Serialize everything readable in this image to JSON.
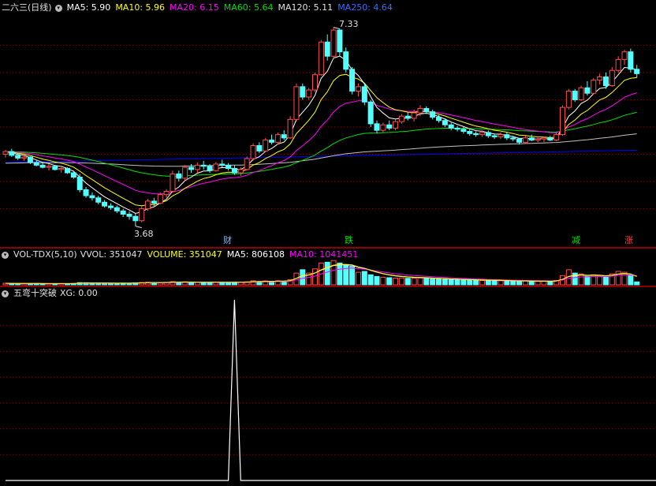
{
  "price_header": {
    "stock_name": "二六三(日线)",
    "ma5": "MA5: 5.90",
    "ma10": "MA10: 5.96",
    "ma20": "MA20: 6.15",
    "ma60": "MA60: 5.64",
    "ma120": "MA120: 5.11",
    "ma250": "MA250: 4.64"
  },
  "price_annotations": {
    "high": "7.33",
    "low": "3.68",
    "tags": [
      {
        "text": "财",
        "color": "#7fbfff"
      },
      {
        "text": "跌",
        "color": "#00e000"
      },
      {
        "text": "减",
        "color": "#00e000"
      },
      {
        "text": "涨",
        "color": "#ff4040"
      }
    ]
  },
  "vol_header": {
    "name": "VOL-TDX(5,10)",
    "vvol": "VVOL: 351047",
    "volume": "VOLUME: 351047",
    "ma5": "MA5: 806108",
    "ma10": "MA10: 1041451"
  },
  "ind_header": {
    "name": "五弯十突破",
    "xg": "XG: 0.00"
  },
  "colors": {
    "up": "#ff4c4c",
    "down": "#54ffff",
    "ma5": "#ffffff",
    "ma10": "#ffff00",
    "ma20": "#ff00ff",
    "ma60": "#00e000",
    "ma120": "#c0c0c0",
    "ma250": "#0000ff",
    "grid": "#8b0000"
  },
  "chart_data": [
    {
      "type": "candlestick",
      "title": "二六三(日线)",
      "ylim": [
        3.4,
        7.6
      ],
      "candles": [
        [
          5.0,
          5.08,
          4.94,
          5.05
        ],
        [
          5.05,
          5.1,
          4.95,
          4.98
        ],
        [
          4.98,
          5.02,
          4.9,
          4.93
        ],
        [
          4.93,
          4.98,
          4.88,
          4.95
        ],
        [
          4.95,
          4.96,
          4.82,
          4.85
        ],
        [
          4.85,
          4.9,
          4.78,
          4.8
        ],
        [
          4.8,
          4.86,
          4.74,
          4.76
        ],
        [
          4.76,
          4.82,
          4.7,
          4.78
        ],
        [
          4.78,
          4.8,
          4.7,
          4.72
        ],
        [
          4.72,
          4.76,
          4.66,
          4.74
        ],
        [
          4.74,
          4.76,
          4.64,
          4.66
        ],
        [
          4.66,
          4.7,
          4.55,
          4.58
        ],
        [
          4.58,
          4.64,
          4.3,
          4.35
        ],
        [
          4.35,
          4.4,
          4.2,
          4.24
        ],
        [
          4.24,
          4.3,
          4.15,
          4.2
        ],
        [
          4.2,
          4.24,
          4.08,
          4.12
        ],
        [
          4.12,
          4.16,
          4.02,
          4.05
        ],
        [
          4.05,
          4.1,
          3.98,
          4.02
        ],
        [
          4.02,
          4.06,
          3.92,
          3.96
        ],
        [
          3.96,
          4.0,
          3.85,
          3.9
        ],
        [
          3.9,
          3.95,
          3.8,
          3.86
        ],
        [
          3.86,
          3.92,
          3.68,
          3.78
        ],
        [
          3.78,
          4.05,
          3.75,
          4.0
        ],
        [
          4.0,
          4.18,
          3.96,
          4.14
        ],
        [
          4.14,
          4.2,
          4.05,
          4.1
        ],
        [
          4.1,
          4.3,
          4.08,
          4.26
        ],
        [
          4.26,
          4.36,
          4.2,
          4.32
        ],
        [
          4.32,
          4.7,
          4.3,
          4.64
        ],
        [
          4.64,
          4.7,
          4.5,
          4.56
        ],
        [
          4.56,
          4.8,
          4.52,
          4.76
        ],
        [
          4.76,
          4.82,
          4.66,
          4.72
        ],
        [
          4.72,
          4.85,
          4.66,
          4.8
        ],
        [
          4.8,
          4.88,
          4.72,
          4.78
        ],
        [
          4.78,
          4.82,
          4.66,
          4.7
        ],
        [
          4.7,
          4.86,
          4.68,
          4.82
        ],
        [
          4.82,
          4.9,
          4.76,
          4.8
        ],
        [
          4.8,
          4.84,
          4.7,
          4.74
        ],
        [
          4.74,
          4.8,
          4.62,
          4.66
        ],
        [
          4.66,
          4.76,
          4.6,
          4.72
        ],
        [
          4.72,
          4.96,
          4.7,
          4.92
        ],
        [
          4.92,
          5.2,
          4.88,
          5.16
        ],
        [
          5.16,
          5.22,
          5.02,
          5.06
        ],
        [
          5.06,
          5.3,
          5.04,
          5.26
        ],
        [
          5.26,
          5.36,
          5.18,
          5.22
        ],
        [
          5.22,
          5.4,
          5.18,
          5.36
        ],
        [
          5.36,
          5.44,
          5.26,
          5.3
        ],
        [
          5.3,
          5.7,
          5.28,
          5.64
        ],
        [
          5.64,
          6.3,
          5.6,
          6.24
        ],
        [
          6.24,
          6.3,
          6.0,
          6.05
        ],
        [
          6.05,
          6.22,
          6.0,
          6.18
        ],
        [
          6.18,
          6.5,
          6.14,
          6.46
        ],
        [
          6.46,
          7.1,
          6.44,
          7.06
        ],
        [
          7.06,
          7.2,
          6.72,
          6.8
        ],
        [
          6.8,
          7.33,
          6.76,
          7.28
        ],
        [
          7.28,
          7.3,
          6.8,
          6.88
        ],
        [
          6.88,
          6.96,
          6.5,
          6.56
        ],
        [
          6.56,
          6.6,
          6.1,
          6.16
        ],
        [
          6.16,
          6.3,
          6.06,
          6.24
        ],
        [
          6.24,
          6.3,
          5.9,
          5.96
        ],
        [
          5.96,
          6.0,
          5.5,
          5.56
        ],
        [
          5.56,
          5.62,
          5.38,
          5.44
        ],
        [
          5.44,
          5.58,
          5.4,
          5.54
        ],
        [
          5.54,
          5.62,
          5.44,
          5.48
        ],
        [
          5.48,
          5.64,
          5.44,
          5.6
        ],
        [
          5.6,
          5.74,
          5.56,
          5.7
        ],
        [
          5.7,
          5.76,
          5.62,
          5.66
        ],
        [
          5.66,
          5.82,
          5.6,
          5.76
        ],
        [
          5.76,
          5.9,
          5.7,
          5.84
        ],
        [
          5.84,
          5.88,
          5.74,
          5.78
        ],
        [
          5.78,
          5.82,
          5.64,
          5.68
        ],
        [
          5.68,
          5.72,
          5.58,
          5.62
        ],
        [
          5.62,
          5.66,
          5.5,
          5.54
        ],
        [
          5.54,
          5.58,
          5.44,
          5.48
        ],
        [
          5.48,
          5.52,
          5.42,
          5.46
        ],
        [
          5.46,
          5.5,
          5.38,
          5.42
        ],
        [
          5.42,
          5.46,
          5.34,
          5.38
        ],
        [
          5.38,
          5.42,
          5.32,
          5.36
        ],
        [
          5.36,
          5.44,
          5.32,
          5.4
        ],
        [
          5.4,
          5.44,
          5.3,
          5.34
        ],
        [
          5.34,
          5.38,
          5.28,
          5.32
        ],
        [
          5.32,
          5.4,
          5.28,
          5.36
        ],
        [
          5.36,
          5.4,
          5.26,
          5.3
        ],
        [
          5.3,
          5.34,
          5.24,
          5.28
        ],
        [
          5.28,
          5.3,
          5.18,
          5.22
        ],
        [
          5.22,
          5.34,
          5.2,
          5.3
        ],
        [
          5.3,
          5.36,
          5.24,
          5.26
        ],
        [
          5.26,
          5.32,
          5.22,
          5.28
        ],
        [
          5.28,
          5.32,
          5.22,
          5.3
        ],
        [
          5.3,
          5.34,
          5.24,
          5.26
        ],
        [
          5.26,
          5.4,
          5.24,
          5.36
        ],
        [
          5.36,
          5.9,
          5.34,
          5.86
        ],
        [
          5.86,
          6.2,
          5.82,
          6.16
        ],
        [
          6.16,
          6.2,
          5.96,
          6.0
        ],
        [
          6.0,
          6.26,
          5.98,
          6.22
        ],
        [
          6.22,
          6.34,
          6.08,
          6.12
        ],
        [
          6.12,
          6.4,
          6.1,
          6.36
        ],
        [
          6.36,
          6.48,
          6.28,
          6.42
        ],
        [
          6.42,
          6.5,
          6.2,
          6.26
        ],
        [
          6.26,
          6.6,
          6.24,
          6.54
        ],
        [
          6.54,
          6.8,
          6.5,
          6.74
        ],
        [
          6.74,
          6.92,
          6.64,
          6.88
        ],
        [
          6.88,
          6.94,
          6.5,
          6.56
        ],
        [
          6.56,
          6.64,
          6.4,
          6.48
        ]
      ]
    },
    {
      "type": "bar",
      "title": "VOL-TDX(5,10)",
      "ylim": [
        0,
        3200000
      ],
      "values": [
        180000,
        160000,
        150000,
        140000,
        150000,
        160000,
        140000,
        130000,
        140000,
        150000,
        140000,
        160000,
        260000,
        250000,
        220000,
        210000,
        200000,
        190000,
        180000,
        200000,
        190000,
        240000,
        280000,
        300000,
        260000,
        280000,
        300000,
        380000,
        320000,
        360000,
        300000,
        280000,
        300000,
        290000,
        320000,
        300000,
        280000,
        300000,
        290000,
        360000,
        480000,
        400000,
        460000,
        420000,
        480000,
        440000,
        620000,
        1400000,
        1800000,
        1400000,
        1900000,
        2600000,
        2700000,
        2900000,
        2600000,
        2400000,
        2200000,
        1500000,
        1600000,
        1200000,
        1000000,
        900000,
        850000,
        800000,
        820000,
        780000,
        800000,
        820000,
        760000,
        700000,
        680000,
        650000,
        620000,
        600000,
        580000,
        560000,
        540000,
        520000,
        500000,
        520000,
        480000,
        460000,
        440000,
        420000,
        450000,
        430000,
        410000,
        420000,
        400000,
        520000,
        1100000,
        1800000,
        1400000,
        1300000,
        1000000,
        1200000,
        1100000,
        900000,
        1300000,
        1600000,
        1500000,
        1100000,
        351047
      ]
    },
    {
      "type": "line",
      "title": "五弯十突破",
      "ylim": [
        0,
        1
      ],
      "values": [
        0,
        0,
        0,
        0,
        0,
        0,
        0,
        0,
        0,
        0,
        0,
        0,
        0,
        0,
        0,
        0,
        0,
        0,
        0,
        0,
        0,
        0,
        0,
        0,
        0,
        0,
        0,
        0,
        0,
        0,
        0,
        0,
        0,
        0,
        0,
        0,
        0,
        0,
        0,
        0,
        0,
        0,
        0,
        0,
        0,
        0,
        0,
        0,
        0,
        0,
        0,
        0,
        0,
        0,
        0,
        0,
        0,
        0,
        0,
        0,
        0,
        0,
        0,
        0,
        0,
        0,
        0,
        0,
        0,
        0,
        0,
        0,
        0,
        0,
        0,
        0,
        0,
        0,
        0,
        0,
        0,
        0,
        0,
        0,
        0,
        0,
        0,
        0,
        0,
        0,
        0,
        0,
        0,
        0,
        0,
        0,
        0,
        0,
        0,
        0,
        0,
        0,
        0,
        0,
        0,
        0,
        0
      ],
      "spike_index": 37
    }
  ]
}
